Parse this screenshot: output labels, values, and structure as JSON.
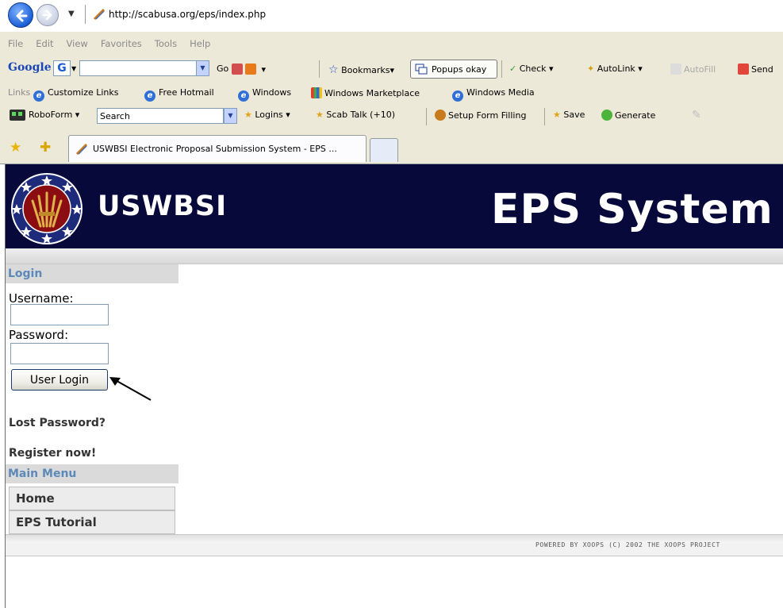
{
  "browser": {
    "url": "http://scabusa.org/eps/index.php",
    "menu": [
      "File",
      "Edit",
      "View",
      "Favorites",
      "Tools",
      "Help"
    ],
    "google_toolbar": {
      "logo": "Google",
      "g_button": "G",
      "go": "Go",
      "bookmarks": "Bookmarks",
      "popups": "Popups okay",
      "check": "Check",
      "autolink": "AutoLink",
      "autofill": "AutoFill",
      "send": "Send"
    },
    "links_bar": {
      "label": "Links",
      "items": [
        "Customize Links",
        "Free Hotmail",
        "Windows",
        "Windows Marketplace",
        "Windows Media"
      ]
    },
    "roboform": {
      "label": "RoboForm",
      "search": "Search",
      "logins": "Logins",
      "scab_talk": "Scab Talk (+10)",
      "setup": "Setup Form Filling",
      "save": "Save",
      "generate": "Generate"
    },
    "tab_title": "USWBSI Electronic Proposal Submission System - EPS ..."
  },
  "site": {
    "brand": "USWBSI",
    "system_title": "EPS System",
    "login": {
      "title": "Login",
      "username_label": "Username:",
      "username_value": "",
      "password_label": "Password:",
      "password_value": "",
      "button": "User Login",
      "lost_password": "Lost Password?",
      "register": "Register now!"
    },
    "main_menu": {
      "title": "Main Menu",
      "items": [
        "Home",
        "EPS Tutorial"
      ]
    },
    "footer": "POWERED BY XOOPS (C) 2002 THE XOOPS PROJECT"
  },
  "colors": {
    "header_bg": "#07093a",
    "block_title": "#5c89b8",
    "block_bg": "#dadada"
  }
}
